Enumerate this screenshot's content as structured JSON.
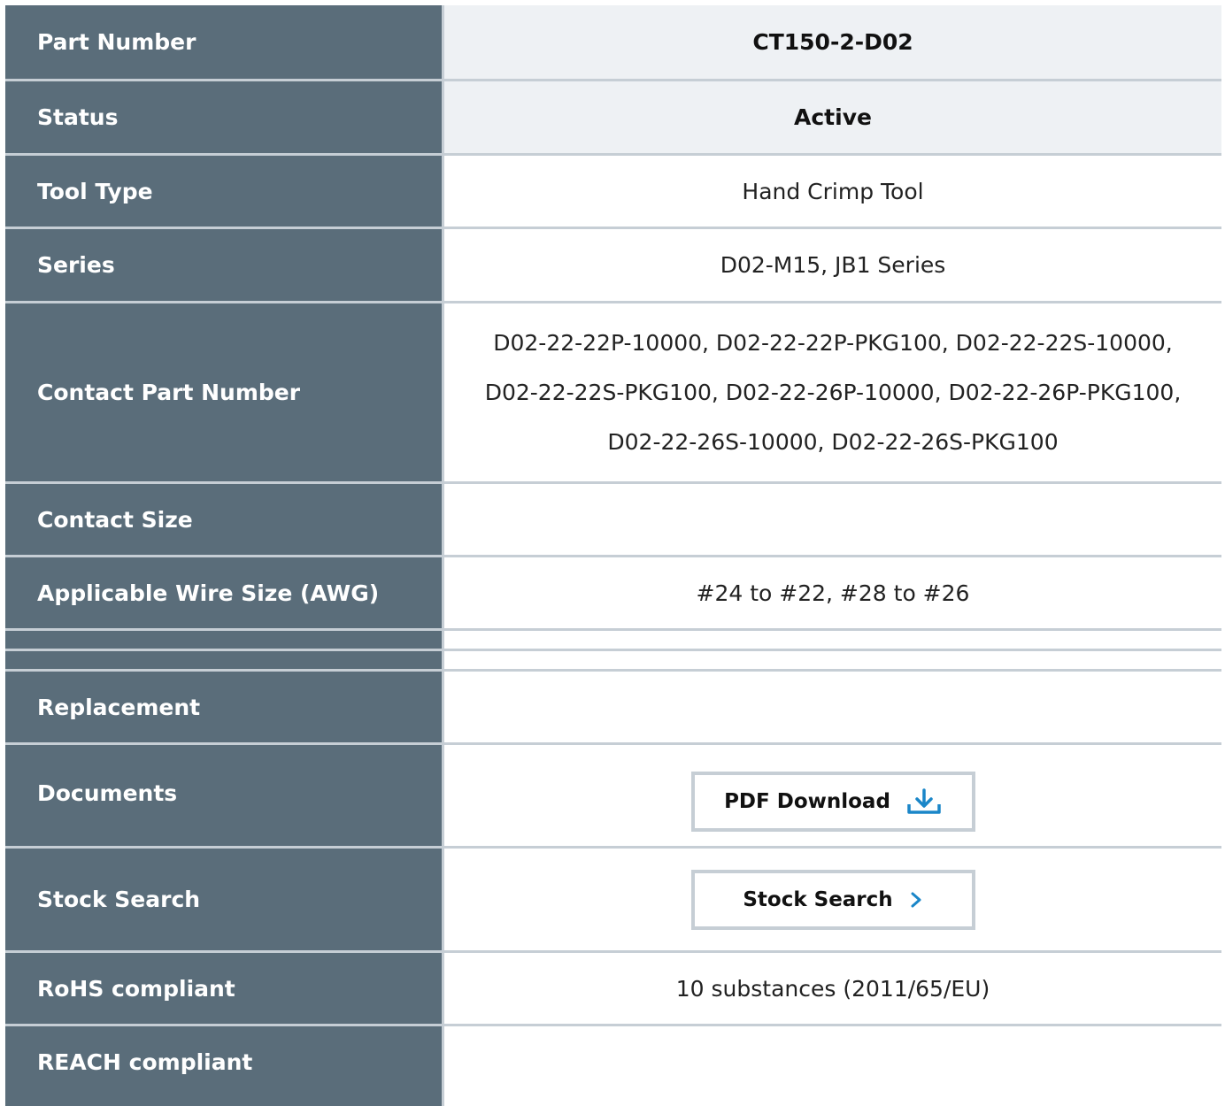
{
  "rows": [
    {
      "label": "Part Number",
      "value": "CT150-2-D02"
    },
    {
      "label": "Status",
      "value": "Active"
    },
    {
      "label": "Tool Type",
      "value": "Hand Crimp Tool"
    },
    {
      "label": "Series",
      "value": "D02-M15, JB1 Series"
    },
    {
      "label": "Contact Part Number",
      "value": "D02-22-22P-10000, D02-22-22P-PKG100, D02-22-22S-10000, D02-22-22S-PKG100, D02-22-26P-10000, D02-22-26P-PKG100, D02-22-26S-10000, D02-22-26S-PKG100"
    },
    {
      "label": "Contact Size",
      "value": ""
    },
    {
      "label": "Applicable Wire Size (AWG)",
      "value": "#24 to #22, #28 to #26"
    },
    {
      "label": "",
      "value": ""
    },
    {
      "label": "",
      "value": ""
    },
    {
      "label": "Replacement",
      "value": ""
    },
    {
      "label": "Documents",
      "button": "PDF Download",
      "icon": "download-icon"
    },
    {
      "label": "Stock Search",
      "button": "Stock Search",
      "icon": "chevron-right-icon"
    },
    {
      "label": "RoHS compliant",
      "value": "10 substances (2011/65/EU)"
    },
    {
      "label": "REACH compliant",
      "value": ""
    }
  ],
  "colors": {
    "header_bg": "#5a6d7a",
    "border": "#c6ced5",
    "shaded_bg": "#eef1f4",
    "accent": "#1a86c8"
  }
}
